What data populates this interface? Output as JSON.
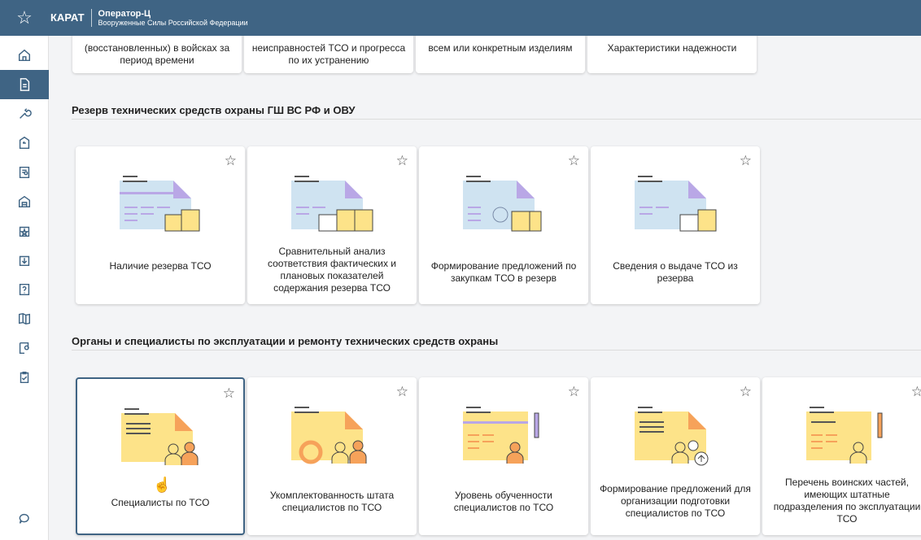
{
  "topbar": {
    "brand": "КАРАТ",
    "app_name": "Оператор-Ц",
    "app_subtitle": "Вооруженные Силы Российской Федерации"
  },
  "top_cards": [
    "(восстановленных) в войсках за период времени",
    "неисправностей ТСО и прогресса по их устранению",
    "всем или конкретным изделиям",
    "Характеристики надежности"
  ],
  "sections": [
    {
      "title": "Резерв технических средств охраны ГШ ВС РФ и ОВУ",
      "cards": [
        "Наличие резерва ТСО",
        "Сравнительный анализ соответствия фактических и плановых показателей содержания резерва ТСО",
        "Формирование предложений по закупкам ТСО в резерв",
        "Сведения о выдаче ТСО из резерва"
      ]
    },
    {
      "title": "Органы и специалисты по эксплуатации и ремонту технических средств охраны",
      "cards": [
        "Специалисты по ТСО",
        "Укомплектованность штата специалистов по ТСО",
        "Уровень обученности специалистов по ТСО",
        "Формирование предложений для организации подготовки специалистов по ТСО",
        "Перечень воинских частей, имеющих штатные подразделения по эксплуатации ТСО"
      ]
    }
  ],
  "colors": {
    "accent": "#3f6484",
    "card_purple": "#b9a7e6",
    "card_blue": "#cfe3f1",
    "card_yellow": "#fde389",
    "orange": "#f6a25a"
  }
}
